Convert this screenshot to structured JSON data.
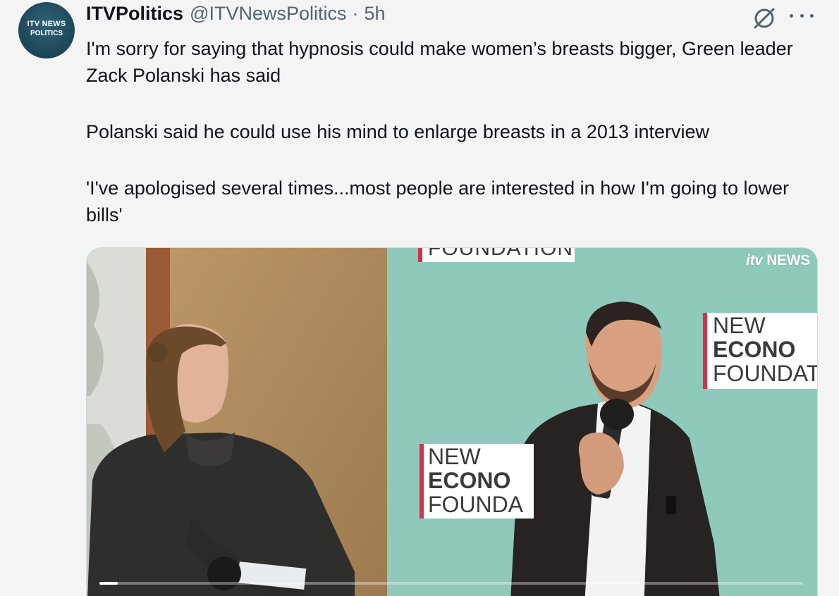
{
  "account": {
    "avatar_line1": "ITV NEWS",
    "avatar_line2": "POLITICS",
    "name": "ITVPolitics",
    "handle": "@ITVNewsPolitics",
    "separator": "·",
    "time": "5h"
  },
  "tweet": {
    "paragraph1": "I'm sorry for saying that hypnosis could make women’s breasts bigger, Green leader Zack Polanski has said",
    "paragraph2": "Polanski said he could use his mind to enlarge breasts in a 2013 interview",
    "paragraph3": "'I've apologised several times...most people are interested in how I'm going to lower bills'"
  },
  "media": {
    "broadcaster_badge_brand": "itv",
    "broadcaster_badge_word": "NEWS",
    "sign_top": "FOUNDATION",
    "sign_right": [
      "NEW",
      "ECONO",
      "FOUNDAT"
    ],
    "sign_mid": [
      "NEW",
      "ECONO",
      "FOUNDA"
    ],
    "progress_fraction": 0.026
  },
  "icons": {
    "grok": "grok-icon",
    "more": "more-icon"
  },
  "colors": {
    "text": "#0f1419",
    "secondary": "#536471",
    "background": "#f4f4f4",
    "sign_accent": "#d2334b",
    "backdrop_teal": "#8ec9bb"
  }
}
